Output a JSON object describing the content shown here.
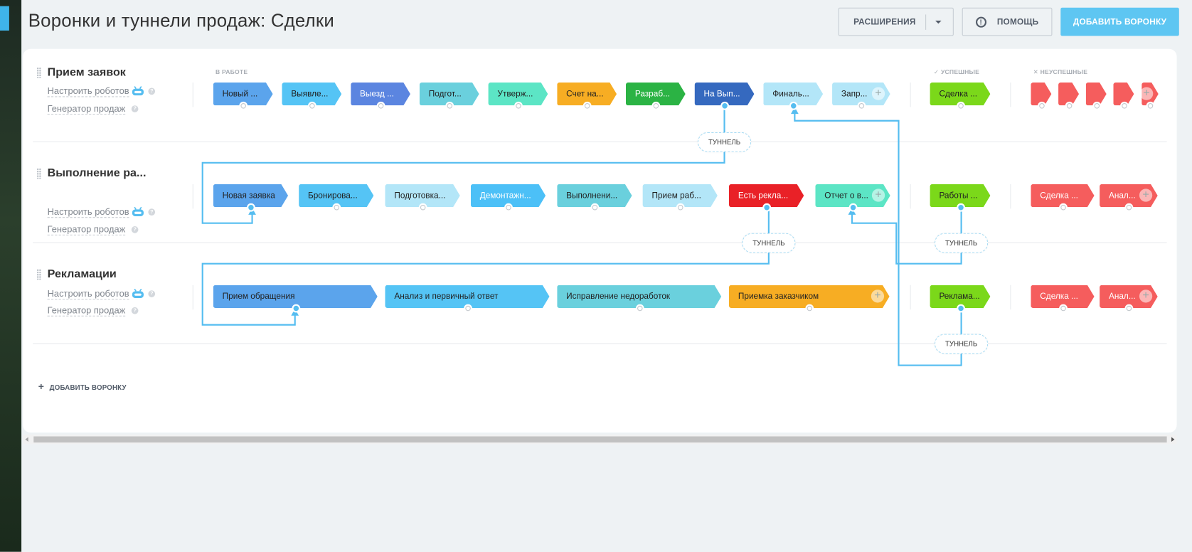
{
  "header": {
    "title": "Воронки и туннели продаж: Сделки",
    "extensions_label": "РАСШИРЕНИЯ",
    "help_label": "ПОМОЩЬ",
    "add_funnel_label": "ДОБАВИТЬ ВОРОНКУ"
  },
  "groups": {
    "in_progress": "В РАБОТЕ",
    "success": "УСПЕШНЫЕ",
    "failure": "НЕУСПЕШНЫЕ"
  },
  "links": {
    "robots": "Настроить роботов",
    "generator": "Генератор продаж"
  },
  "tunnel_label": "ТУННЕЛЬ",
  "add_funnel_bottom": "ДОБАВИТЬ ВОРОНКУ",
  "funnels": [
    {
      "title": "Прием заявок",
      "stages": [
        {
          "label": "Новый ...",
          "color": "#5ba4ec"
        },
        {
          "label": "Выявле...",
          "color": "#55c4f5"
        },
        {
          "label": "Выезд ...",
          "color": "#5b85e0",
          "white": true
        },
        {
          "label": "Подгот...",
          "color": "#6ad0dd"
        },
        {
          "label": "Утверж...",
          "color": "#5ce5c5"
        },
        {
          "label": "Счет на...",
          "color": "#f7ad23"
        },
        {
          "label": "Разраб...",
          "color": "#2bb344",
          "white": true
        },
        {
          "label": "На Вып...",
          "color": "#3569bf",
          "white": true,
          "connected": true
        },
        {
          "label": "Финаль...",
          "color": "#b3e6f8",
          "connected": true
        },
        {
          "label": "Запр...",
          "color": "#b3e6f8"
        }
      ],
      "success": [
        {
          "label": "Сделка ...",
          "color": "#7bd81a"
        }
      ],
      "failure": [
        {
          "label": "",
          "color": "#f55d5d"
        },
        {
          "label": "",
          "color": "#f55d5d"
        },
        {
          "label": "",
          "color": "#f55d5d"
        },
        {
          "label": "",
          "color": "#f55d5d"
        },
        {
          "label": "",
          "color": "#f55d5d"
        }
      ]
    },
    {
      "title": "Выполнение ра...",
      "stages": [
        {
          "label": "Новая заявка",
          "color": "#5ba4ec",
          "connected": true
        },
        {
          "label": "Бронирова...",
          "color": "#55c4f5"
        },
        {
          "label": "Подготовка...",
          "color": "#b3e6f8"
        },
        {
          "label": "Демонтажн...",
          "color": "#4cc0f7",
          "white": true
        },
        {
          "label": "Выполнени...",
          "color": "#6ad0dd"
        },
        {
          "label": "Прием раб...",
          "color": "#b3e6f8"
        },
        {
          "label": "Есть рекла...",
          "color": "#e92127",
          "white": true,
          "connected": true
        },
        {
          "label": "Отчет о в...",
          "color": "#5ce5c5",
          "connected": true
        }
      ],
      "success": [
        {
          "label": "Работы ...",
          "color": "#7bd81a",
          "connected": true
        }
      ],
      "failure": [
        {
          "label": "Сделка ...",
          "color": "#f55d5d",
          "white": true
        },
        {
          "label": "Анал...",
          "color": "#f55d5d",
          "white": true
        }
      ]
    },
    {
      "title": "Рекламации",
      "stages": [
        {
          "label": "Прием обращения",
          "color": "#5ba4ec",
          "connected": true
        },
        {
          "label": "Анализ и первичный ответ",
          "color": "#55c4f5"
        },
        {
          "label": "Исправление недоработок",
          "color": "#6ad0dd"
        },
        {
          "label": "Приемка заказчиком",
          "color": "#f7ad23"
        }
      ],
      "success": [
        {
          "label": "Реклама...",
          "color": "#7bd81a",
          "connected": true
        }
      ],
      "failure": [
        {
          "label": "Сделка ...",
          "color": "#f55d5d",
          "white": true
        },
        {
          "label": "Анал...",
          "color": "#f55d5d",
          "white": true
        }
      ]
    }
  ],
  "tunnels": [
    {
      "from": "На Вып...",
      "to": "Новая заявка"
    },
    {
      "from": "Есть рекла...",
      "to": "Прием обращения"
    },
    {
      "from": "Работы ...",
      "to": "Отчет о в..."
    },
    {
      "from": "Реклама...",
      "to": "Финаль..."
    }
  ]
}
